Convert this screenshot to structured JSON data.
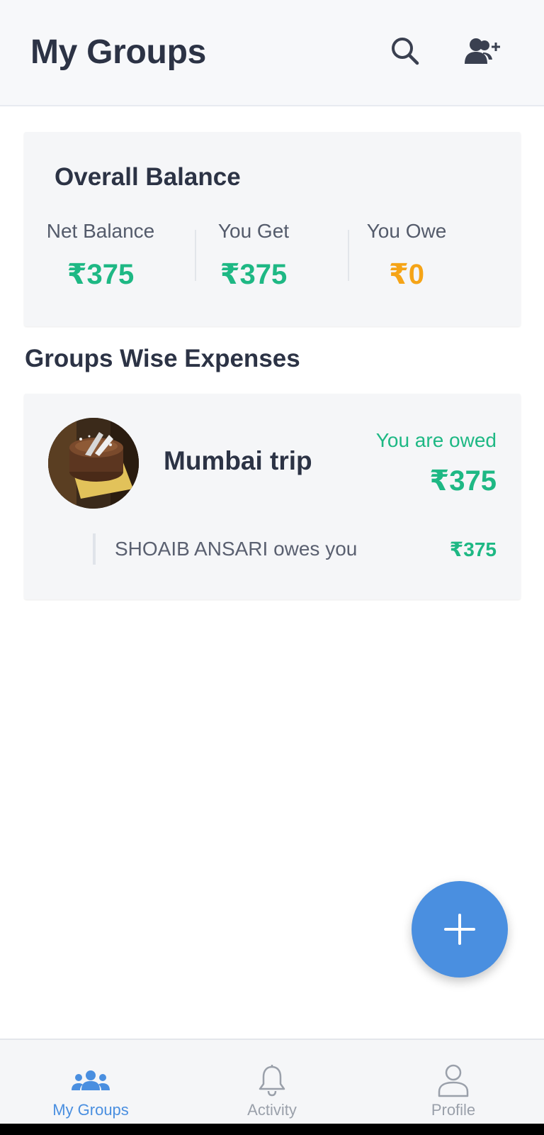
{
  "header": {
    "title": "My Groups",
    "search_icon": "search-icon",
    "add_user_icon": "add-user-icon"
  },
  "overall_balance": {
    "title": "Overall Balance",
    "columns": [
      {
        "label": "Net Balance",
        "value": "₹375",
        "color": "#1eb884"
      },
      {
        "label": "You Get",
        "value": "₹375",
        "color": "#1eb884"
      },
      {
        "label": "You Owe",
        "value": "₹0",
        "color": "#f5a417"
      }
    ]
  },
  "section_title": "Groups Wise Expenses",
  "groups": [
    {
      "name": "Mumbai trip",
      "status": "You are owed",
      "amount": "₹375",
      "details": [
        {
          "text": "SHOAIB ANSARI owes you",
          "amount": "₹375"
        }
      ]
    }
  ],
  "fab": {
    "icon": "plus-icon"
  },
  "bottom_nav": {
    "items": [
      {
        "label": "My Groups",
        "icon": "groups-icon",
        "active": true
      },
      {
        "label": "Activity",
        "icon": "bell-icon",
        "active": false
      },
      {
        "label": "Profile",
        "icon": "user-icon",
        "active": false
      }
    ]
  },
  "colors": {
    "accent": "#4a8fe0",
    "positive": "#1eb884",
    "owe": "#f5a417",
    "text": "#2c3345"
  }
}
